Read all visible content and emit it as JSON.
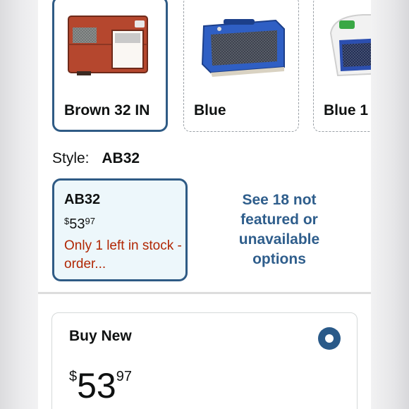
{
  "swatches": [
    {
      "label": "Brown 32 IN",
      "selected": true,
      "image_icon": "brown-pet-crate",
      "color": "#b5472e"
    },
    {
      "label": "Blue",
      "selected": false,
      "image_icon": "blue-pet-crate",
      "color": "#2f5fc4"
    },
    {
      "label": "Blue 1",
      "selected": false,
      "image_icon": "blue-white-pet-crate",
      "color": "#2c4fb0"
    }
  ],
  "style": {
    "key_label": "Style:",
    "value": "AB32"
  },
  "style_option": {
    "name": "AB32",
    "currency": "$",
    "price_whole": "53",
    "price_cents": "97",
    "stock_text": "Only 1 left in stock - order..."
  },
  "see_more_text": "See 18 not featured or unavailable options",
  "buy_new": {
    "title": "Buy New",
    "selected": true,
    "currency": "$",
    "price_whole": "53",
    "price_cents": "97"
  },
  "colors": {
    "accent_border": "#2f5b85",
    "link": "#2f5e8c",
    "stock_red": "#b12704",
    "selected_card_bg": "#edf7fb"
  }
}
